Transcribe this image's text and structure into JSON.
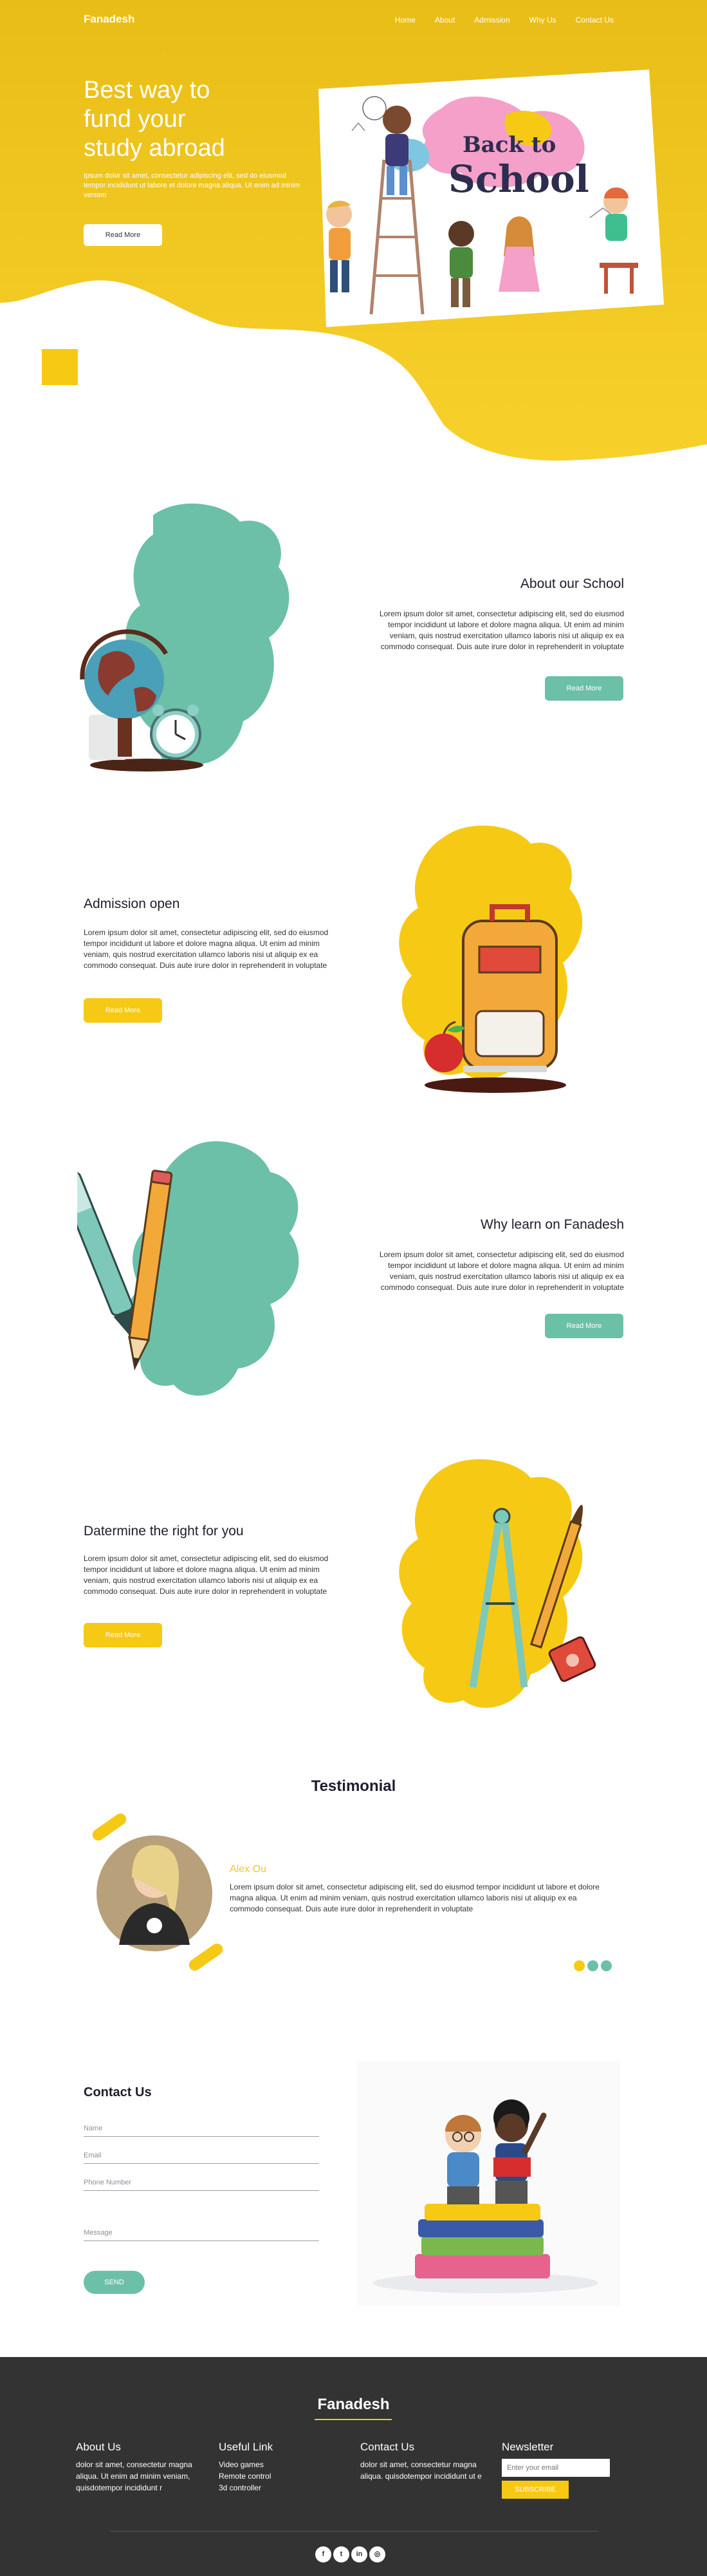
{
  "colors": {
    "yellow": "#f6c915",
    "teal": "#6cc0a8",
    "footer_bg": "#333333",
    "text_dark": "#1e1e2e"
  },
  "header": {
    "logo": "Fanadesh",
    "nav": [
      "Home",
      "About",
      "Admission",
      "Why Us",
      "Contact Us"
    ]
  },
  "hero": {
    "title_line1": "Best way to",
    "title_line2": "fund your",
    "title_line3": "study abroad",
    "text": "Ipsum dolor sit amet, consectetur adipiscing elit, sed do eiusmod tempor incididunt ut labore et dolore magna aliqua. Ut enim ad minim veniam",
    "button": "Read More",
    "board_line1": "Back to",
    "board_line2": "School"
  },
  "sections": [
    {
      "title": "About our School",
      "text": "Lorem ipsum dolor sit amet, consectetur adipiscing elit, sed do eiusmod tempor incididunt ut labore et dolore magna aliqua. Ut enim ad minim veniam, quis nostrud exercitation ullamco laboris nisi ut aliquip ex ea commodo consequat. Duis aute irure dolor in reprehenderit in voluptate",
      "button": "Read More",
      "image_icon": "globe-clock-icon"
    },
    {
      "title": "Admission open",
      "text": "Lorem ipsum dolor sit amet, consectetur adipiscing elit, sed do eiusmod tempor incididunt ut labore et dolore magna aliqua. Ut enim ad minim veniam, quis nostrud exercitation ullamco laboris nisi ut aliquip ex ea commodo consequat. Duis aute irure dolor in reprehenderit in voluptate",
      "button": "Read More",
      "image_icon": "backpack-apple-icon"
    },
    {
      "title": "Why learn on Fanadesh",
      "text": "Lorem ipsum dolor sit amet, consectetur adipiscing elit, sed do eiusmod tempor incididunt ut labore et dolore magna aliqua. Ut enim ad minim veniam, quis nostrud exercitation ullamco laboris nisi ut aliquip ex ea commodo consequat. Duis aute irure dolor in reprehenderit in voluptate",
      "button": "Read More",
      "image_icon": "pen-pencil-icon"
    },
    {
      "title": "Datermine the right for you",
      "text": "Lorem ipsum dolor sit amet, consectetur adipiscing elit, sed do eiusmod tempor incididunt ut labore et dolore magna aliqua. Ut enim ad minim veniam, quis nostrud exercitation ullamco laboris nisi ut aliquip ex ea commodo consequat. Duis aute irure dolor in reprehenderit in voluptate",
      "button": "Read More",
      "image_icon": "compass-brush-icon"
    }
  ],
  "testimonial": {
    "title": "Testimonial",
    "name": "Alex Ou",
    "text": "Lorem ipsum dolor sit amet, consectetur adipiscing elit, sed do eiusmod tempor incididunt ut labore et dolore magna aliqua. Ut enim ad minim veniam, quis nostrud exercitation ullamco laboris nisi ut aliquip ex ea commodo consequat. Duis aute irure dolor in reprehenderit in voluptate",
    "dots": [
      "#f6c915",
      "#6cc0a8",
      "#6cc0a8"
    ]
  },
  "contact": {
    "title": "Contact Us",
    "name_placeholder": "Name",
    "email_placeholder": "Email",
    "phone_placeholder": "Phone Number",
    "message_placeholder": "Message",
    "send": "SEND",
    "image_icon": "kids-on-books-icon"
  },
  "footer": {
    "logo": "Fanadesh",
    "about_title": "About Us",
    "about_text": "dolor sit amet, consectetur magna aliqua. Ut enim ad minim veniam, quisdotempor incididunt r",
    "links_title": "Useful Link",
    "links": [
      "Video games",
      "Remote control",
      "3d controller"
    ],
    "contact_title": "Contact Us",
    "contact_text": "dolor sit amet, consectetur magna aliqua. quisdotempor incididunt ut e",
    "newsletter_title": "Newsletter",
    "newsletter_placeholder": "Enter your email",
    "subscribe": "SUBSCRIBE",
    "social": [
      {
        "icon": "facebook-icon",
        "glyph": "f"
      },
      {
        "icon": "twitter-icon",
        "glyph": "t"
      },
      {
        "icon": "linkedin-icon",
        "glyph": "in"
      },
      {
        "icon": "instagram-icon",
        "glyph": "◎"
      }
    ]
  }
}
